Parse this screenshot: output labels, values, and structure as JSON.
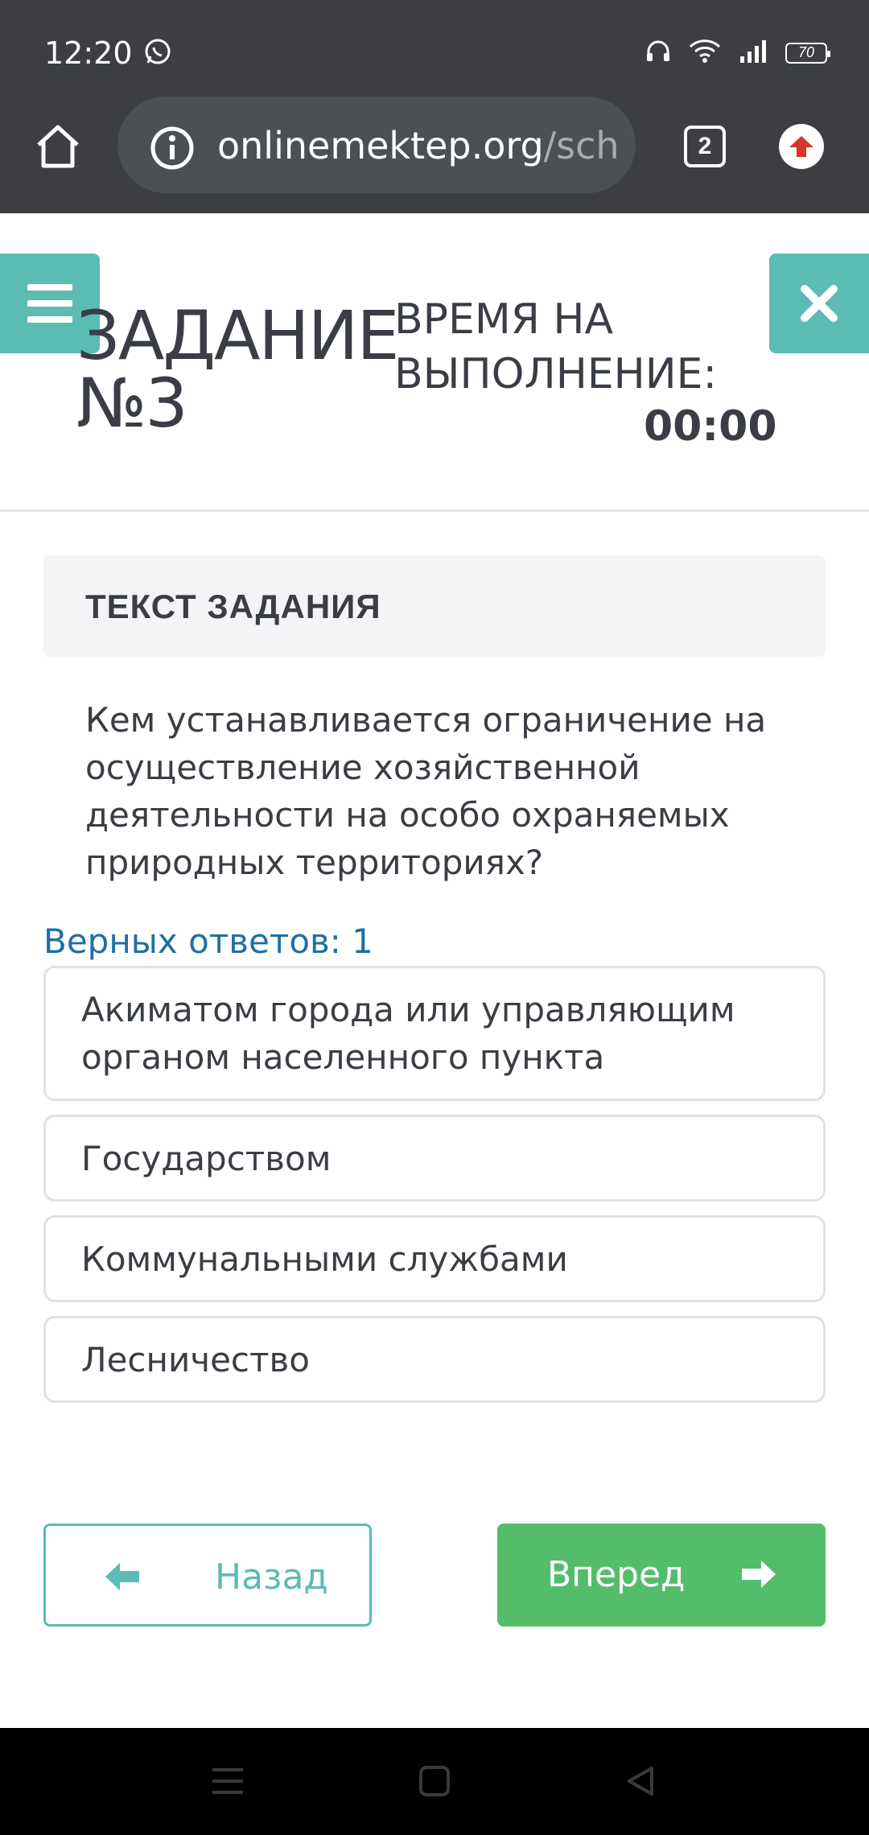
{
  "status_bar": {
    "time": "12:20",
    "battery": "70",
    "icons": [
      "whatsapp-icon",
      "headset-icon",
      "wifi-icon",
      "signal-icon",
      "battery-icon"
    ]
  },
  "browser": {
    "url_main": "onlinemektep.org",
    "url_dim": "/sche",
    "tab_count": "2"
  },
  "header": {
    "task_line1": "ЗАДАНИЕ",
    "task_line2": "№3",
    "time_label_line1": "ВРЕМЯ НА",
    "time_label_line2": "ВЫПОЛНЕНИЕ:",
    "time_value": "00:00"
  },
  "task": {
    "header": "ТЕКСТ ЗАДАНИЯ",
    "question": "Кем устанавливается ограничение на осуществление хозяйственной деятельности на особо охраняемых природных территориях?",
    "correct_count": "Верных ответов: 1"
  },
  "answers": [
    "Акиматом города или управляющим органом населенного пункта",
    "Государством",
    "Коммунальными службами",
    "Лесничество"
  ],
  "buttons": {
    "back": "Назад",
    "next": "Вперед"
  },
  "colors": {
    "accent_teal": "#5bbcb3",
    "next_green": "#54bd6c",
    "link_blue": "#1f6fa5",
    "chrome_dark": "#3c3e41"
  }
}
